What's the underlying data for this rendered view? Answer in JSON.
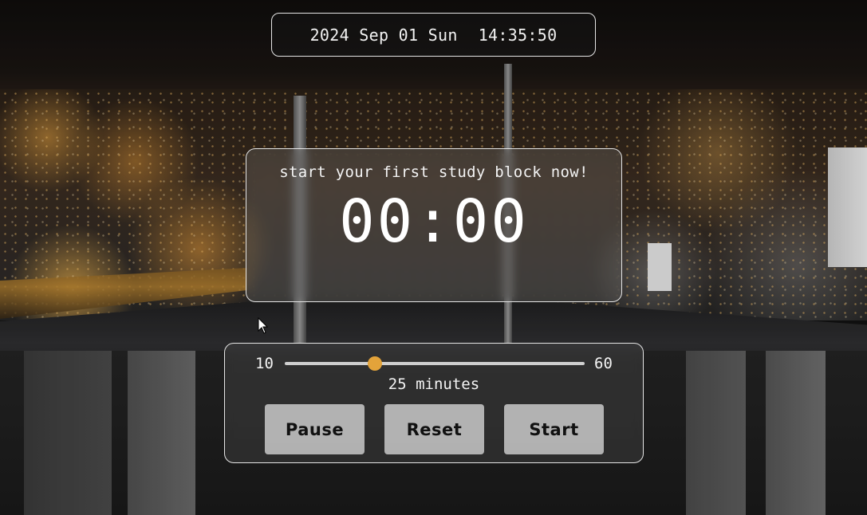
{
  "header": {
    "date": "2024 Sep 01 Sun",
    "time": "14:35:50"
  },
  "timer": {
    "message": "start your first study block now!",
    "display": "00:00"
  },
  "slider": {
    "min_label": "10",
    "max_label": "60",
    "min": 10,
    "max": 60,
    "value": 25,
    "duration_label": "25 minutes"
  },
  "buttons": {
    "pause": "Pause",
    "reset": "Reset",
    "start": "Start"
  },
  "colors": {
    "accent": "#e3a33a"
  }
}
